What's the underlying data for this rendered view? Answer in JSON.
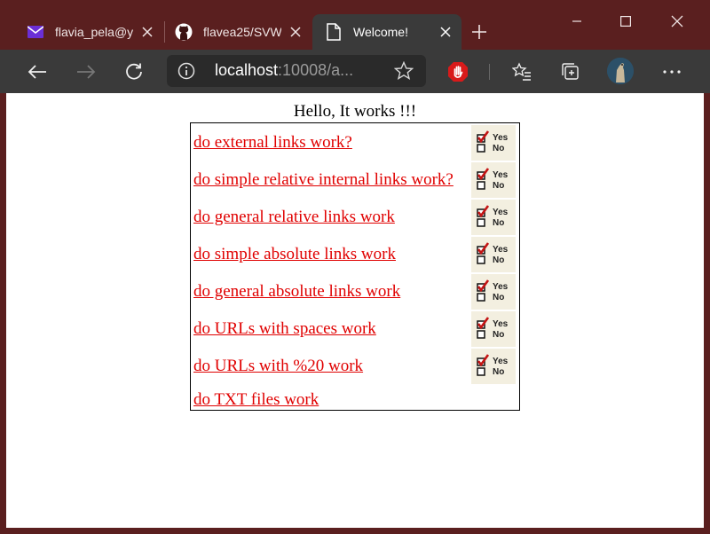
{
  "browser": {
    "tabs": [
      {
        "title": "flavia_pela@y",
        "icon": "mail-icon",
        "active": false
      },
      {
        "title": "flavea25/SVW",
        "icon": "github-icon",
        "active": false
      },
      {
        "title": "Welcome!",
        "icon": "page-icon",
        "active": true
      }
    ],
    "address": {
      "host": "localhost",
      "rest": ":10008/a..."
    },
    "colors": {
      "titlebar": "#5a1f1f",
      "toolbar": "#3a3a3a",
      "link": "#e00000",
      "blocker": "#d81a1a"
    }
  },
  "page": {
    "heading": "Hello, It works !!!",
    "links": [
      {
        "label": "do external links work?",
        "has_checkbox": true
      },
      {
        "label": "do simple relative internal links work?",
        "has_checkbox": true
      },
      {
        "label": "do general relative links work",
        "has_checkbox": true
      },
      {
        "label": "do simple absolute links work",
        "has_checkbox": true
      },
      {
        "label": "do general absolute links work",
        "has_checkbox": true
      },
      {
        "label": "do URLs with spaces work",
        "has_checkbox": true
      },
      {
        "label": "do URLs with %20 work",
        "has_checkbox": true
      },
      {
        "label": "do TXT files work",
        "has_checkbox": false
      }
    ],
    "checkbox_labels": {
      "yes": "Yes",
      "no": "No"
    }
  }
}
